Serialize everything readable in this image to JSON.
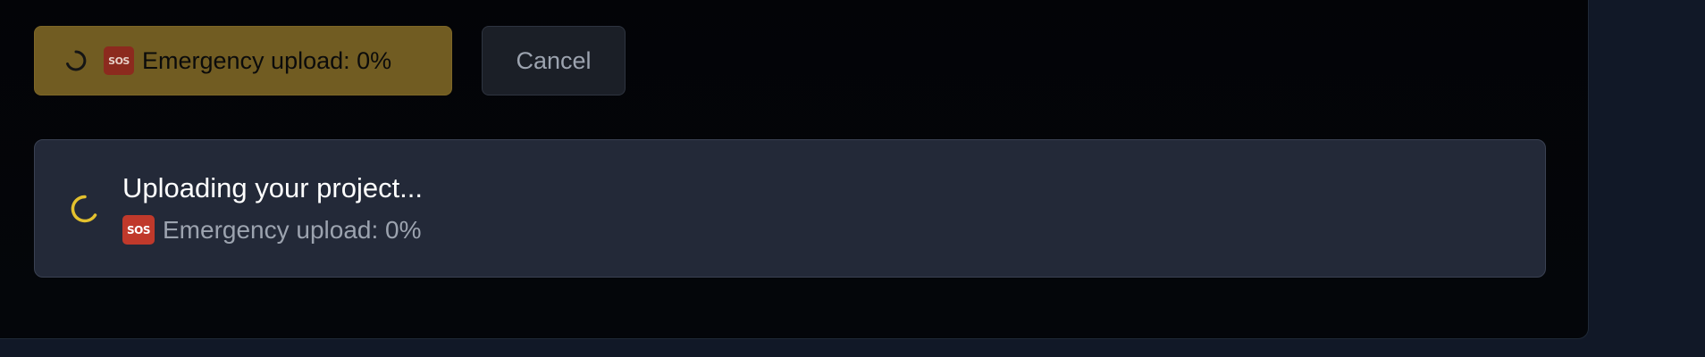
{
  "upload_button": {
    "sos_emoji": "🆘",
    "sos_text": "SOS",
    "label": "Emergency upload: 0%",
    "spinner_icon": "spinner-icon"
  },
  "cancel_button": {
    "label": "Cancel"
  },
  "status_card": {
    "title": "Uploading your project...",
    "sos_emoji": "🆘",
    "sos_text": "SOS",
    "subtitle": "Emergency upload: 0%",
    "spinner_icon": "spinner-icon",
    "progress_percent": 0
  },
  "colors": {
    "accent": "#715c22",
    "spinner_yellow": "#e4c12e",
    "card_bg": "#232938",
    "sos_red": "#c0392b"
  }
}
